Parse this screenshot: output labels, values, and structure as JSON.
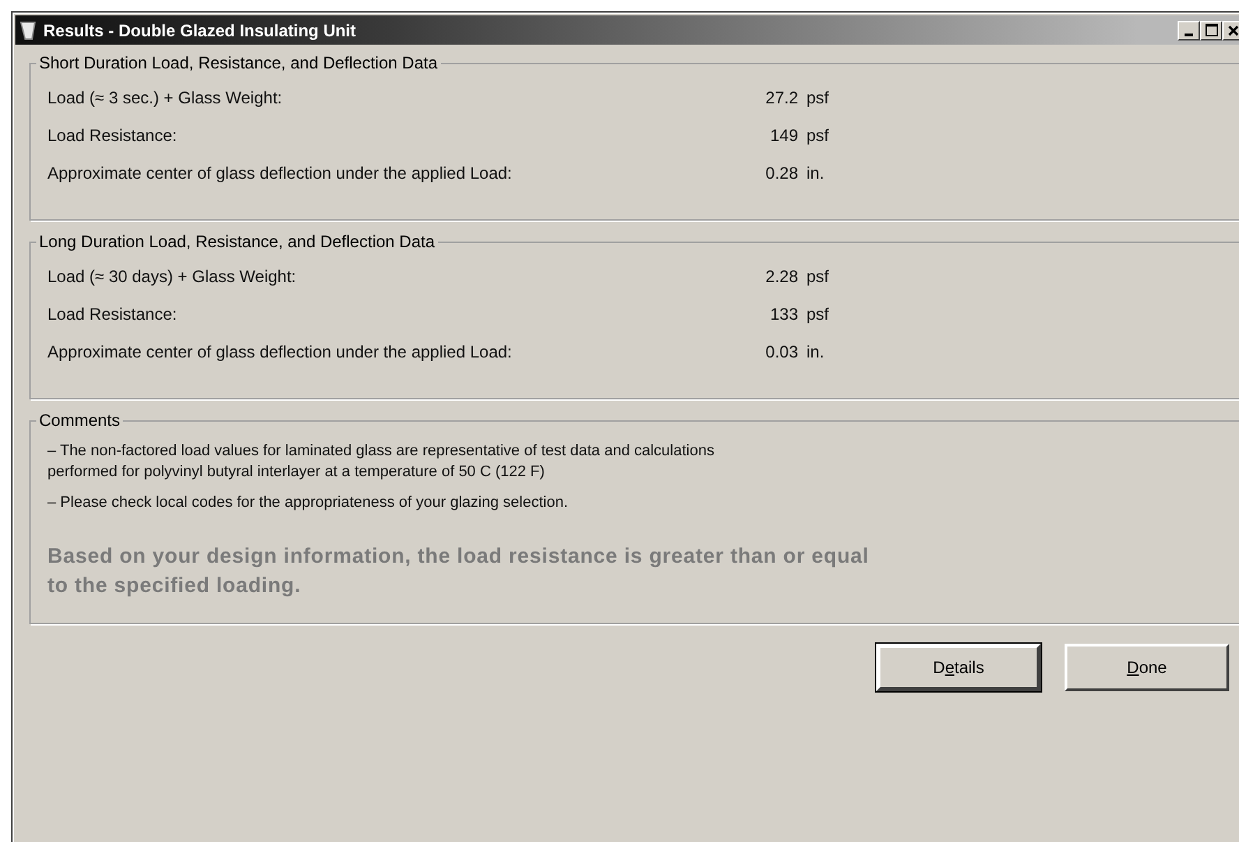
{
  "window": {
    "title": "Results - Double Glazed Insulating Unit"
  },
  "groups": [
    {
      "title": "Short Duration Load, Resistance, and Deflection Data",
      "rows": [
        {
          "label": "Load (≈ 3 sec.) + Glass Weight:",
          "value": "27.2",
          "unit": "psf"
        },
        {
          "label": "Load Resistance:",
          "value": "149",
          "unit": "psf"
        },
        {
          "label": "Approximate center of glass deflection under the applied Load:",
          "value": "0.28",
          "unit": "in."
        }
      ]
    },
    {
      "title": "Long Duration Load, Resistance, and Deflection Data",
      "rows": [
        {
          "label": "Load (≈ 30 days) + Glass Weight:",
          "value": "2.28",
          "unit": "psf"
        },
        {
          "label": "Load Resistance:",
          "value": "133",
          "unit": "psf"
        },
        {
          "label": "Approximate center of glass deflection under the applied Load:",
          "value": "0.03",
          "unit": "in."
        }
      ]
    }
  ],
  "comments": {
    "title": "Comments",
    "notes": [
      "– The non-factored load values for laminated glass are representative of test data and calculations\nperformed for polyvinyl butyral interlayer at a temperature of 50 C (122 F)",
      "– Please check local codes for the appropriateness of your glazing selection."
    ],
    "conclusion": "Based on your design information, the load resistance is greater than or equal\nto the specified loading."
  },
  "buttons": [
    {
      "label_before": "D",
      "access_key": "e",
      "label_after": "tails",
      "default": true
    },
    {
      "access_key": "D",
      "label_after": "one",
      "default": false
    }
  ]
}
